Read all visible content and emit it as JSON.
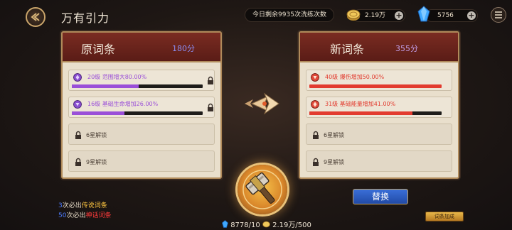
{
  "header": {
    "title": "万有引力",
    "remaining_text": "今日剩余9935次洗练次数",
    "gold": "2.19万",
    "gems": "5756"
  },
  "old_panel": {
    "title": "原词条",
    "score": "180分",
    "rows": [
      {
        "text": "20级 范围增大80.00%",
        "progress": 0.51,
        "color": "#9a4fd8",
        "locked": false
      },
      {
        "text": "16级 基础生命增加26.00%",
        "progress": 0.4,
        "color": "#9a4fd8",
        "locked": false
      },
      {
        "text": "6星解锁",
        "locked": true
      },
      {
        "text": "9星解锁",
        "locked": true
      }
    ]
  },
  "new_panel": {
    "title": "新词条",
    "score": "355分",
    "rows": [
      {
        "text": "40级 爆伤增加50.00%",
        "progress": 1.0,
        "color": "#e23b2f",
        "locked": false
      },
      {
        "text": "31级 基础能量增加41.00%",
        "progress": 0.78,
        "color": "#e23b2f",
        "locked": false
      },
      {
        "text": "6星解锁",
        "locked": true
      },
      {
        "text": "9星解锁",
        "locked": true
      }
    ]
  },
  "guarantees": {
    "legend_count": "3",
    "legend_mid": "次必出",
    "legend_label": "传说词条",
    "myth_count": "50",
    "myth_mid": "次必出",
    "myth_label": "神话词条"
  },
  "cost": {
    "crystal": "8778/10",
    "gold": "2.19万/500"
  },
  "buttons": {
    "replace": "替换",
    "bonus": "词条加成"
  },
  "colors": {
    "accent_purple": "#9a4fd8",
    "accent_red": "#e23b2f",
    "panel_header": "#7a2c22"
  }
}
